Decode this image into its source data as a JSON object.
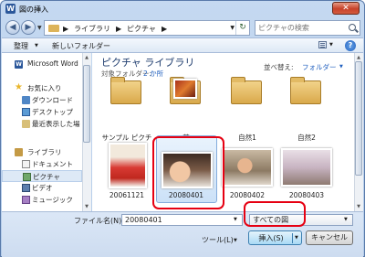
{
  "window": {
    "title": "図の挿入",
    "app_icon": "W",
    "close": "✕"
  },
  "nav_buttons": {
    "back": "◀",
    "forward": "▶"
  },
  "address": {
    "segments": [
      "ライブラリ",
      "ピクチャ"
    ],
    "sep": "▶",
    "dropdown": "▼",
    "refresh": "↻"
  },
  "search": {
    "placeholder": "ピクチャの検索"
  },
  "toolbar": {
    "organize": "整理",
    "new_folder": "新しいフォルダー",
    "help": "?"
  },
  "nav": {
    "items": [
      {
        "label": "Microsoft Word",
        "icon": "word-icon"
      },
      {
        "label": "お気に入り",
        "icon": "star-icon"
      },
      {
        "label": "ダウンロード",
        "icon": "download-folder-icon"
      },
      {
        "label": "デスクトップ",
        "icon": "desktop-icon"
      },
      {
        "label": "最近表示した場",
        "icon": "recent-places-icon"
      },
      {
        "label": "ライブラリ",
        "icon": "library-icon"
      },
      {
        "label": "ドキュメント",
        "icon": "documents-icon"
      },
      {
        "label": "ピクチャ",
        "icon": "pictures-icon"
      },
      {
        "label": "ビデオ",
        "icon": "videos-icon"
      },
      {
        "label": "ミュージック",
        "icon": "music-icon"
      }
    ],
    "selected": "ピクチャ"
  },
  "content": {
    "library_title": "ピクチャ ライブラリ",
    "target_folder_label": "対象フォルダー:",
    "target_folder_value": "2 か所",
    "sort_label": "並べ替え:",
    "sort_value": "フォルダー",
    "items": [
      {
        "caption": "サンプル ピクチャ",
        "type": "folder"
      },
      {
        "caption": "花",
        "type": "folder"
      },
      {
        "caption": "自然1",
        "type": "folder"
      },
      {
        "caption": "自然2",
        "type": "folder"
      },
      {
        "caption": "20061121",
        "type": "photo"
      },
      {
        "caption": "20080401",
        "type": "photo",
        "selected": true
      },
      {
        "caption": "20080402",
        "type": "photo"
      },
      {
        "caption": "20080403",
        "type": "photo"
      }
    ]
  },
  "bottom": {
    "filename_label": "ファイル名(N):",
    "filename_value": "20080401",
    "filetype_value": "すべての図",
    "tools_label": "ツール(L)",
    "insert_label": "挿入(S)",
    "cancel_label": "キャンセル"
  },
  "colors": {
    "highlight": "#e60012",
    "accent": "#1f5fbf"
  }
}
